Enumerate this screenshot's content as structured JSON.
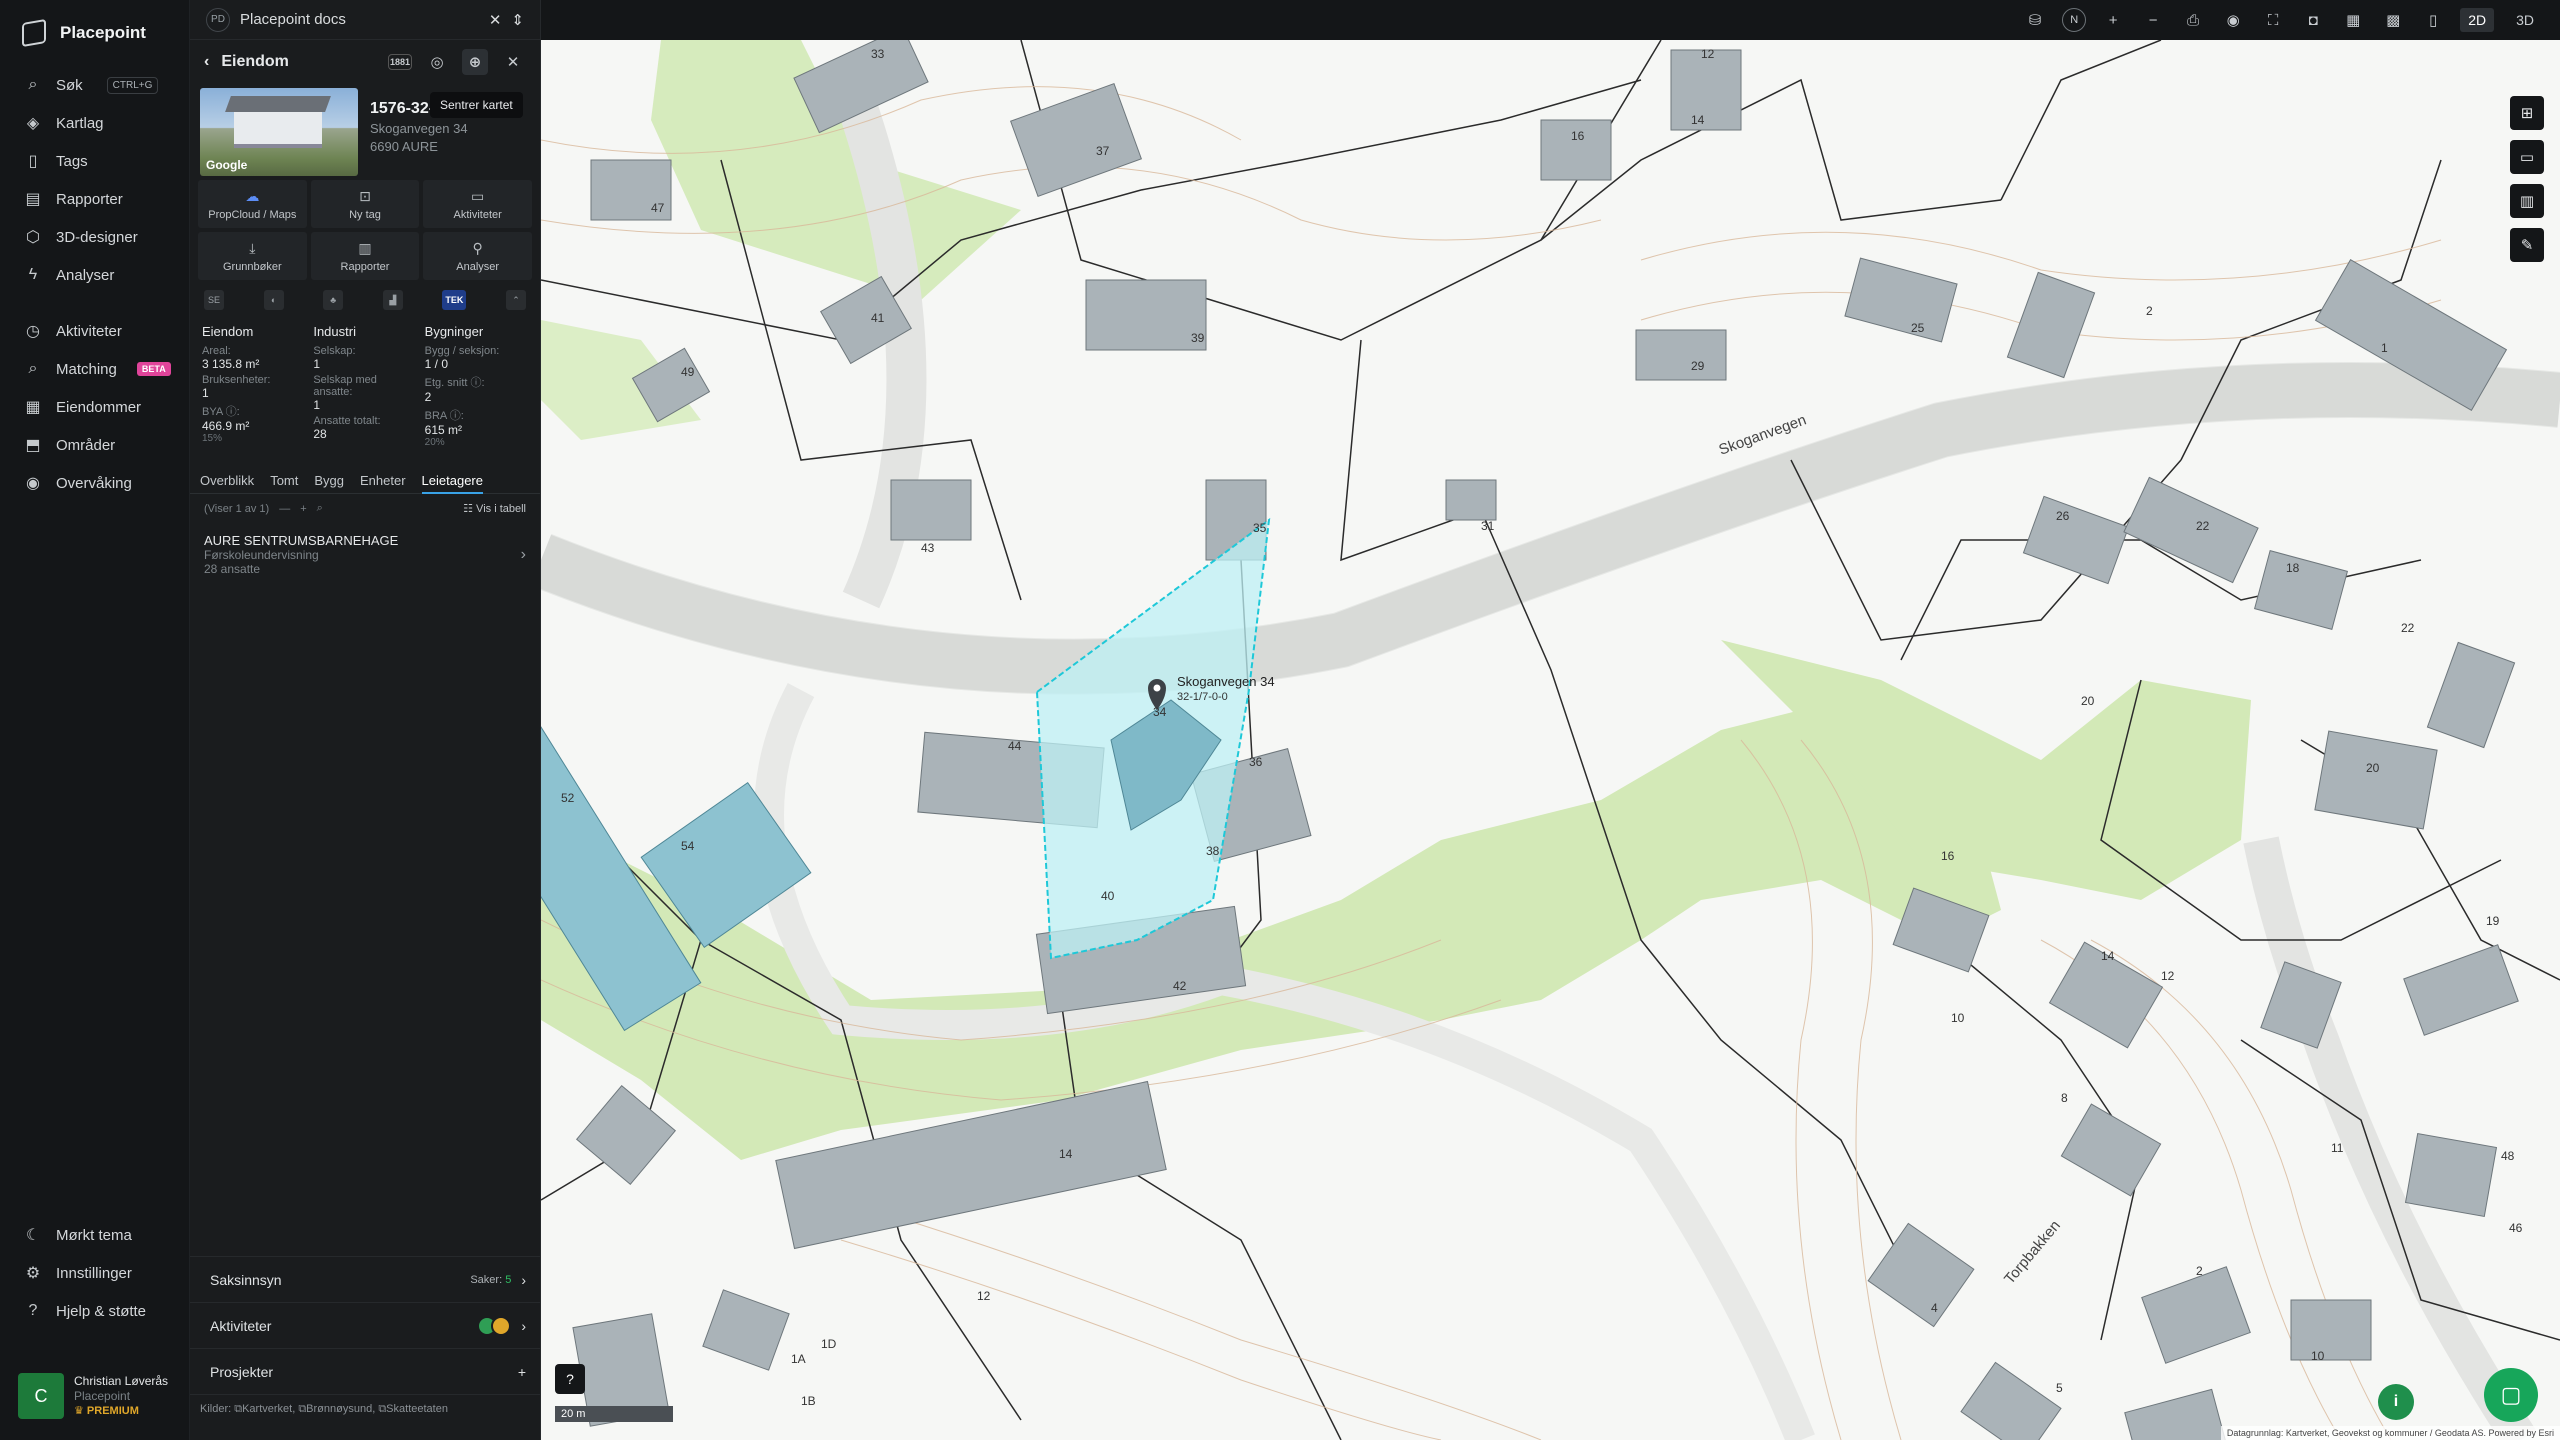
{
  "nav": {
    "brand": "Placepoint",
    "items": [
      {
        "icon": "search-icon",
        "glyph": "⌕",
        "label": "Søk",
        "kbd": "CTRL+G"
      },
      {
        "icon": "layers-icon",
        "glyph": "◈",
        "label": "Kartlag"
      },
      {
        "icon": "bookmark-icon",
        "glyph": "▯",
        "label": "Tags"
      },
      {
        "icon": "chart-icon",
        "glyph": "▤",
        "label": "Rapporter"
      },
      {
        "icon": "cube-icon",
        "glyph": "⬡",
        "label": "3D-designer"
      },
      {
        "icon": "bolt-icon",
        "glyph": "ϟ",
        "label": "Analyser"
      },
      {
        "icon": "activity-icon",
        "glyph": "◷",
        "label": "Aktiviteter"
      },
      {
        "icon": "match-icon",
        "glyph": "⌕",
        "label": "Matching",
        "badge": "BETA"
      },
      {
        "icon": "building-icon",
        "glyph": "▦",
        "label": "Eiendommer"
      },
      {
        "icon": "area-icon",
        "glyph": "⬒",
        "label": "Områder"
      },
      {
        "icon": "monitor-icon",
        "glyph": "◉",
        "label": "Overvåking"
      }
    ],
    "bottom": [
      {
        "icon": "moon-icon",
        "glyph": "☾",
        "label": "Mørkt tema"
      },
      {
        "icon": "gear-icon",
        "glyph": "⚙",
        "label": "Innstillinger"
      },
      {
        "icon": "help-icon",
        "glyph": "?",
        "label": "Hjelp & støtte"
      }
    ],
    "user": {
      "initial": "C",
      "name": "Christian Løverås",
      "org": "Placepoint",
      "tier": "PREMIUM"
    }
  },
  "panel": {
    "doc_badge": "PD",
    "doc_title": "Placepoint docs",
    "title": "Eiendom",
    "hdr_badge": "1881",
    "tooltip": "Sentrer kartet",
    "prop_id": "1576-32-1/7-0-0",
    "address": "Skoganvegen 34",
    "postal": "6690 AURE",
    "photo_credit": "Google",
    "actions": [
      {
        "icon": "cloud-icon",
        "glyph": "☁",
        "label": "PropCloud / Maps"
      },
      {
        "icon": "tag-icon",
        "glyph": "⊡",
        "label": "Ny tag"
      },
      {
        "icon": "comment-icon",
        "glyph": "▭",
        "label": "Aktiviteter"
      },
      {
        "icon": "download-icon",
        "glyph": "⤓",
        "label": "Grunnbøker"
      },
      {
        "icon": "report-icon",
        "glyph": "▥",
        "label": "Rapporter"
      },
      {
        "icon": "pin-icon",
        "glyph": "⚲",
        "label": "Analyser"
      }
    ],
    "sources": [
      {
        "name": "source-se-icon",
        "text": "SE"
      },
      {
        "name": "source-globe-icon",
        "text": "◐"
      },
      {
        "name": "source-tree-icon",
        "text": "♣"
      },
      {
        "name": "source-bars-icon",
        "text": "▟"
      },
      {
        "name": "source-tek-icon",
        "text": "TEK"
      },
      {
        "name": "source-more-icon",
        "text": "⌃"
      }
    ],
    "stats": {
      "eiendom": {
        "title": "Eiendom",
        "areal_l": "Areal:",
        "areal_v": "3 135.8 m²",
        "bruks_l": "Bruksenheter:",
        "bruks_v": "1",
        "bya_l": "BYA ⓘ:",
        "bya_v": "466.9 m²",
        "bya_s": "15%"
      },
      "industri": {
        "title": "Industri",
        "sel_l": "Selskap:",
        "sel_v": "1",
        "selans_l": "Selskap med ansatte:",
        "selans_v": "1",
        "ans_l": "Ansatte totalt:",
        "ans_v": "28"
      },
      "bygninger": {
        "title": "Bygninger",
        "bygg_l": "Bygg / seksjon:",
        "bygg_v": "1 / 0",
        "etg_l": "Etg. snitt ⓘ:",
        "etg_v": "2",
        "bra_l": "BRA ⓘ:",
        "bra_v": "615 m²",
        "bra_s": "20%"
      }
    },
    "tabs": [
      "Overblikk",
      "Tomt",
      "Bygg",
      "Enheter",
      "Leietagere"
    ],
    "active_tab": "Leietagere",
    "list_info": "(Viser 1 av 1)",
    "table_link": "☷ Vis i tabell",
    "tenant": {
      "name": "AURE SENTRUMSBARNEHAGE",
      "sector": "Førskoleundervisning",
      "employees": "28 ansatte"
    },
    "sections": {
      "saksinnsyn": "Saksinnsyn",
      "saker_label": "Saker:",
      "saker_count": "5",
      "aktiviteter": "Aktiviteter",
      "prosjekter": "Prosjekter"
    },
    "kilder": "Kilder: ⧉Kartverket, ⧉Brønnøysund, ⧉Skatteetaten"
  },
  "map": {
    "road_label": "Skoganvegen",
    "road_label2": "Torpbakken",
    "marker_label": "Skoganvegen 34",
    "marker_sub": "32-1/7-0-0",
    "scale": "20 m",
    "attribution": "Datagrunnlag: Kartverket, Geovekst og kommuner / Geodata AS. Powered by Esri",
    "modes": [
      "2D",
      "3D"
    ],
    "active_mode": "2D",
    "north": "N",
    "house_numbers": [
      "33",
      "37",
      "12",
      "14",
      "16",
      "47",
      "41",
      "39",
      "29",
      "25",
      "2",
      "1",
      "49",
      "43",
      "35",
      "31",
      "26",
      "22",
      "18",
      "44",
      "36",
      "38",
      "34",
      "20",
      "20",
      "16",
      "14",
      "12",
      "10",
      "40",
      "42",
      "52",
      "54",
      "8",
      "14",
      "12",
      "11",
      "10",
      "48",
      "46",
      "19",
      "4",
      "2",
      "1A",
      "1B",
      "1D",
      "5",
      "22"
    ]
  },
  "colors": {
    "accent": "#39a2e6",
    "parcel": "#1ec8d8",
    "green": "#cfe8b0",
    "building": "#aab3b8",
    "selected_building": "#7fb9c8"
  }
}
